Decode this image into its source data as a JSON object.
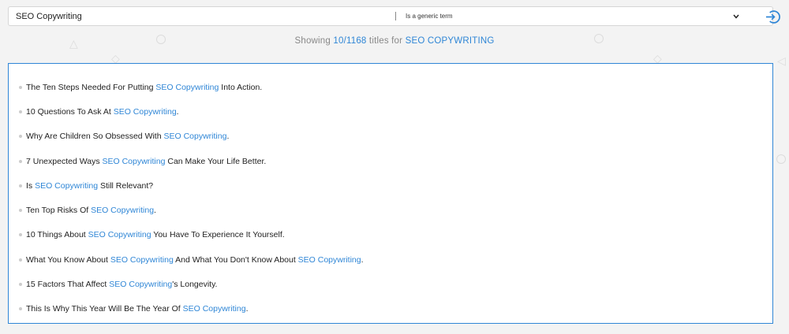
{
  "search": {
    "query_value": "SEO Copywriting",
    "term_type_selected": "Is a generic term"
  },
  "summary": {
    "prefix": "Showing ",
    "count": "10/1168",
    "middle": " titles for ",
    "keyword": "SEO COPYWRITING"
  },
  "results": [
    {
      "parts": [
        {
          "t": "The Ten Steps Needed For Putting "
        },
        {
          "t": "SEO Copywriting",
          "kw": true
        },
        {
          "t": " Into Action."
        }
      ]
    },
    {
      "parts": [
        {
          "t": "10 Questions To Ask At "
        },
        {
          "t": "SEO Copywriting",
          "kw": true
        },
        {
          "t": "."
        }
      ]
    },
    {
      "parts": [
        {
          "t": "Why Are Children So Obsessed With "
        },
        {
          "t": "SEO Copywriting",
          "kw": true
        },
        {
          "t": "."
        }
      ]
    },
    {
      "parts": [
        {
          "t": "7 Unexpected Ways "
        },
        {
          "t": "SEO Copywriting",
          "kw": true
        },
        {
          "t": " Can Make Your Life Better."
        }
      ]
    },
    {
      "parts": [
        {
          "t": "Is "
        },
        {
          "t": "SEO Copywriting",
          "kw": true
        },
        {
          "t": " Still Relevant?"
        }
      ]
    },
    {
      "parts": [
        {
          "t": "Ten Top Risks Of "
        },
        {
          "t": "SEO Copywriting",
          "kw": true
        },
        {
          "t": "."
        }
      ]
    },
    {
      "parts": [
        {
          "t": "10 Things About "
        },
        {
          "t": "SEO Copywriting",
          "kw": true
        },
        {
          "t": " You Have To Experience It Yourself."
        }
      ]
    },
    {
      "parts": [
        {
          "t": "What You Know About "
        },
        {
          "t": "SEO Copywriting",
          "kw": true
        },
        {
          "t": " And What You Don't Know About "
        },
        {
          "t": "SEO Copywriting",
          "kw": true
        },
        {
          "t": "."
        }
      ]
    },
    {
      "parts": [
        {
          "t": "15 Factors That Affect "
        },
        {
          "t": "SEO Copywriting",
          "kw": true
        },
        {
          "t": "'s Longevity."
        }
      ]
    },
    {
      "parts": [
        {
          "t": "This Is Why This Year Will Be The Year Of "
        },
        {
          "t": "SEO Copywriting",
          "kw": true
        },
        {
          "t": "."
        }
      ]
    }
  ],
  "icons": {
    "dropdown": "chevron-down-icon",
    "submit": "arrow-right-circle-icon"
  },
  "colors": {
    "accent": "#2f86d6",
    "background": "#f3f3f3"
  }
}
